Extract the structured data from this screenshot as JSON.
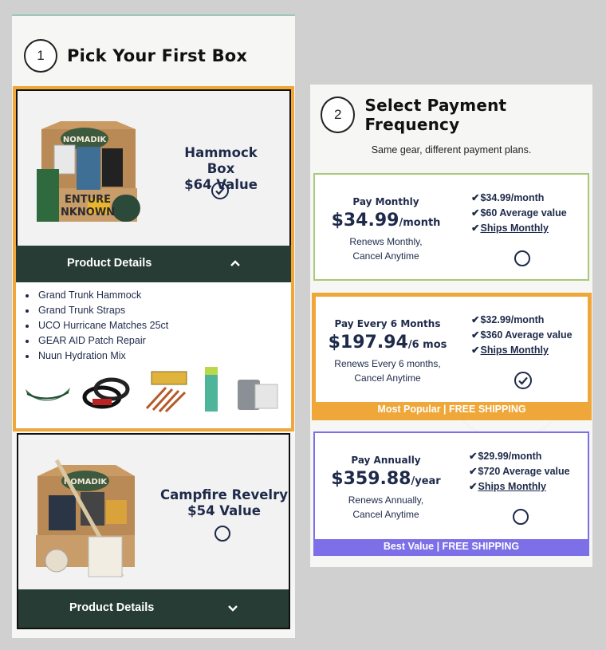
{
  "step1": {
    "number": "1",
    "title": "Pick Your First Box"
  },
  "boxes": [
    {
      "name_line1": "Hammock Box",
      "name_line2": "$64 Value",
      "selected": true,
      "details_label": "Product Details",
      "expanded": true,
      "items": [
        "Grand Trunk Hammock",
        "Grand Trunk Straps",
        "UCO Hurricane Matches 25ct",
        "GEAR AID Patch Repair",
        "Nuun Hydration Mix"
      ],
      "box_brand": "NOMADIK",
      "box_text": "ENTURE",
      "box_text2": "NKNOWN"
    },
    {
      "name_line1": "Campfire Revelry",
      "name_line2": "$54 Value",
      "selected": false,
      "details_label": "Product Details",
      "expanded": false,
      "box_brand": "NOMADIK"
    }
  ],
  "step2": {
    "number": "2",
    "title": "Select Payment Frequency",
    "subtitle": "Same gear, different payment plans."
  },
  "plans": [
    {
      "name": "Pay Monthly",
      "price": "$34.99",
      "unit": "/month",
      "desc_line1": "Renews Monthly,",
      "desc_line2": "Cancel Anytime",
      "features": [
        "$34.99/month",
        "$60 Average value",
        "Ships Monthly"
      ],
      "selected": false,
      "border_color": "#a9c97a"
    },
    {
      "name": "Pay Every 6 Months",
      "price": "$197.94",
      "unit": "/6 mos",
      "desc_line1": "Renews Every 6 months,",
      "desc_line2": "Cancel Anytime",
      "features": [
        "$32.99/month",
        "$360 Average value",
        "Ships Monthly"
      ],
      "selected": true,
      "border_color": "#f0a73a",
      "banner": "Most Popular | FREE SHIPPING"
    },
    {
      "name": "Pay Annually",
      "price": "$359.88",
      "unit": "/year",
      "desc_line1": "Renews Annually,",
      "desc_line2": "Cancel Anytime",
      "features": [
        "$29.99/month",
        "$720 Average value",
        "Ships Monthly"
      ],
      "selected": false,
      "border_color": "#7c6fe8",
      "banner": "Best Value | FREE SHIPPING"
    }
  ],
  "colors": {
    "selected_border": "#f0a73a",
    "dark_green": "#263c35",
    "navy": "#1e2a4a",
    "annual": "#7c6fe8",
    "monthly": "#a9c97a"
  },
  "check_glyph": "✔"
}
